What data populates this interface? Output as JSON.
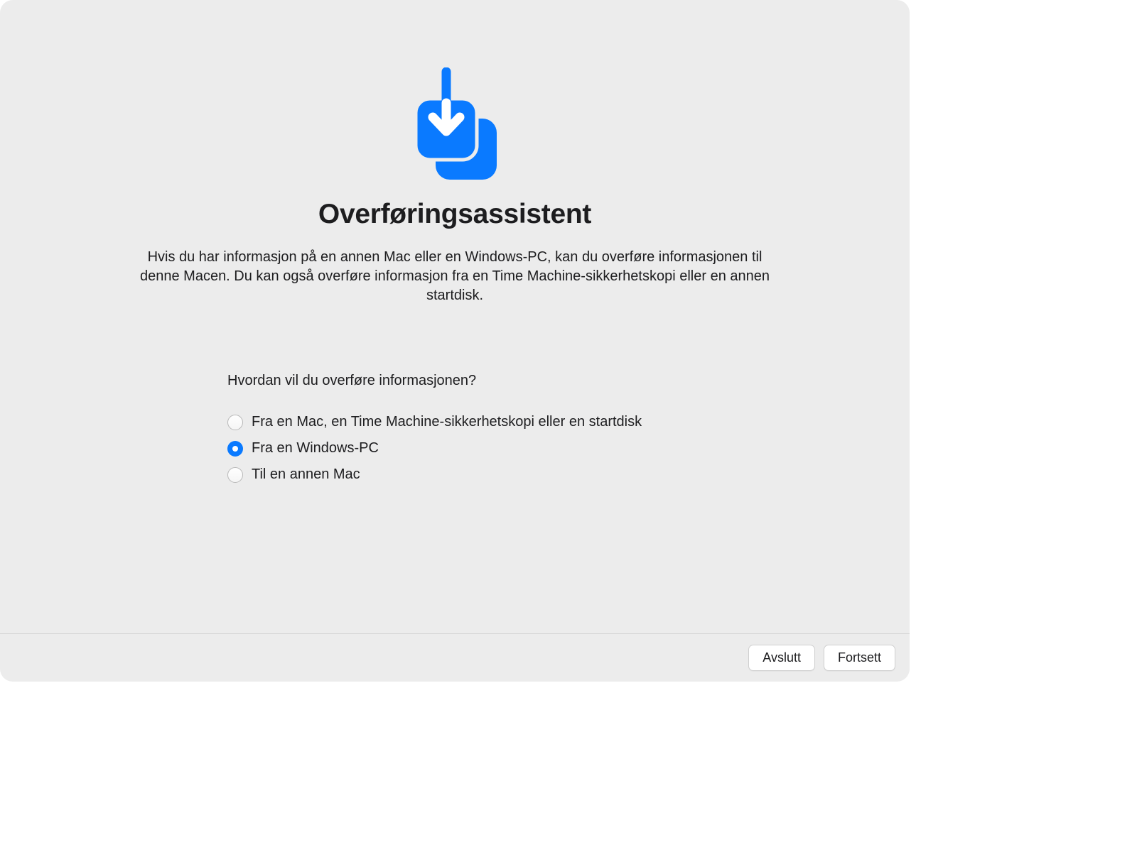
{
  "title": "Overføringsassistent",
  "description": "Hvis du har informasjon på en annen Mac eller en Windows-PC, kan du overføre informasjonen til denne Macen. Du kan også overføre informasjon fra en Time Machine-sikkerhetskopi eller en annen startdisk.",
  "question": "Hvordan vil du overføre informasjonen?",
  "options": [
    {
      "label": "Fra en Mac, en Time Machine-sikkerhetskopi eller en startdisk",
      "selected": false
    },
    {
      "label": "Fra en Windows-PC",
      "selected": true
    },
    {
      "label": "Til en annen Mac",
      "selected": false
    }
  ],
  "footer": {
    "quit_label": "Avslutt",
    "continue_label": "Fortsett"
  },
  "colors": {
    "accent": "#0a7aff"
  }
}
